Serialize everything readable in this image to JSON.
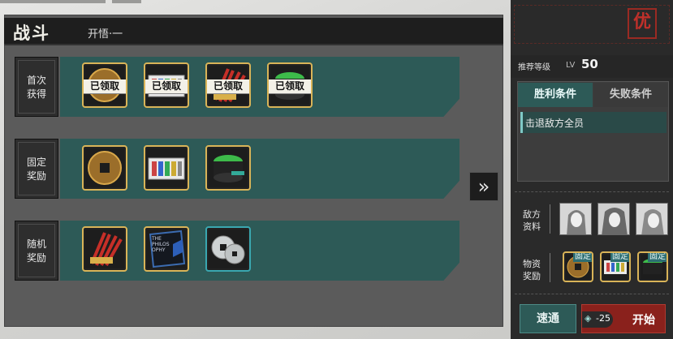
{
  "header": {
    "title": "战斗",
    "subtitle": "开悟·一"
  },
  "rows": [
    {
      "label_lines": [
        "首次",
        "获得"
      ],
      "items": [
        {
          "icon": "coin-icon",
          "overlay": "已领取",
          "border": "gold"
        },
        {
          "icon": "dye-palette-icon",
          "overlay": "已领取",
          "border": "gold"
        },
        {
          "icon": "firecracker-icon",
          "overlay": "已领取",
          "border": "gold"
        },
        {
          "icon": "tea-jar-icon",
          "overlay": "已领取",
          "border": "gold"
        }
      ]
    },
    {
      "label_lines": [
        "固定",
        "奖励"
      ],
      "items": [
        {
          "icon": "coin-icon",
          "overlay": "",
          "border": "gold"
        },
        {
          "icon": "dye-palette-icon",
          "overlay": "",
          "border": "gold"
        },
        {
          "icon": "tea-jar-icon",
          "overlay": "",
          "border": "gold"
        }
      ]
    },
    {
      "label_lines": [
        "随机",
        "奖励"
      ],
      "items": [
        {
          "icon": "firecracker-icon",
          "overlay": "",
          "border": "gold"
        },
        {
          "icon": "book-icon",
          "overlay": "",
          "border": "gold",
          "book_text": "THE PHILOS OPHY"
        },
        {
          "icon": "silver-coins-icon",
          "overlay": "",
          "border": "blue"
        }
      ]
    }
  ],
  "right": {
    "logo": "优",
    "recommend_label": "推荐等级",
    "lv_prefix": "LV",
    "level": "50",
    "tabs": [
      "胜利条件",
      "失败条件"
    ],
    "victory_condition": "击退敌方全员",
    "enemy_label": [
      "敌方",
      "资料"
    ],
    "enemies": [
      "enemy-portrait-1",
      "enemy-portrait-2",
      "enemy-portrait-3"
    ],
    "material_label": [
      "物资",
      "奖励"
    ],
    "materials": [
      {
        "icon": "coin-icon",
        "tag": "固定"
      },
      {
        "icon": "dye-palette-icon",
        "tag": "固定"
      },
      {
        "icon": "tea-jar-icon",
        "tag": "固定"
      }
    ],
    "quick_label": "速通",
    "cost": "-25",
    "start_label": "开始"
  },
  "colors": {
    "teal": "#2d5a57",
    "gold": "#d9b458",
    "red": "#8a211c",
    "dark": "#1e1e1e"
  }
}
